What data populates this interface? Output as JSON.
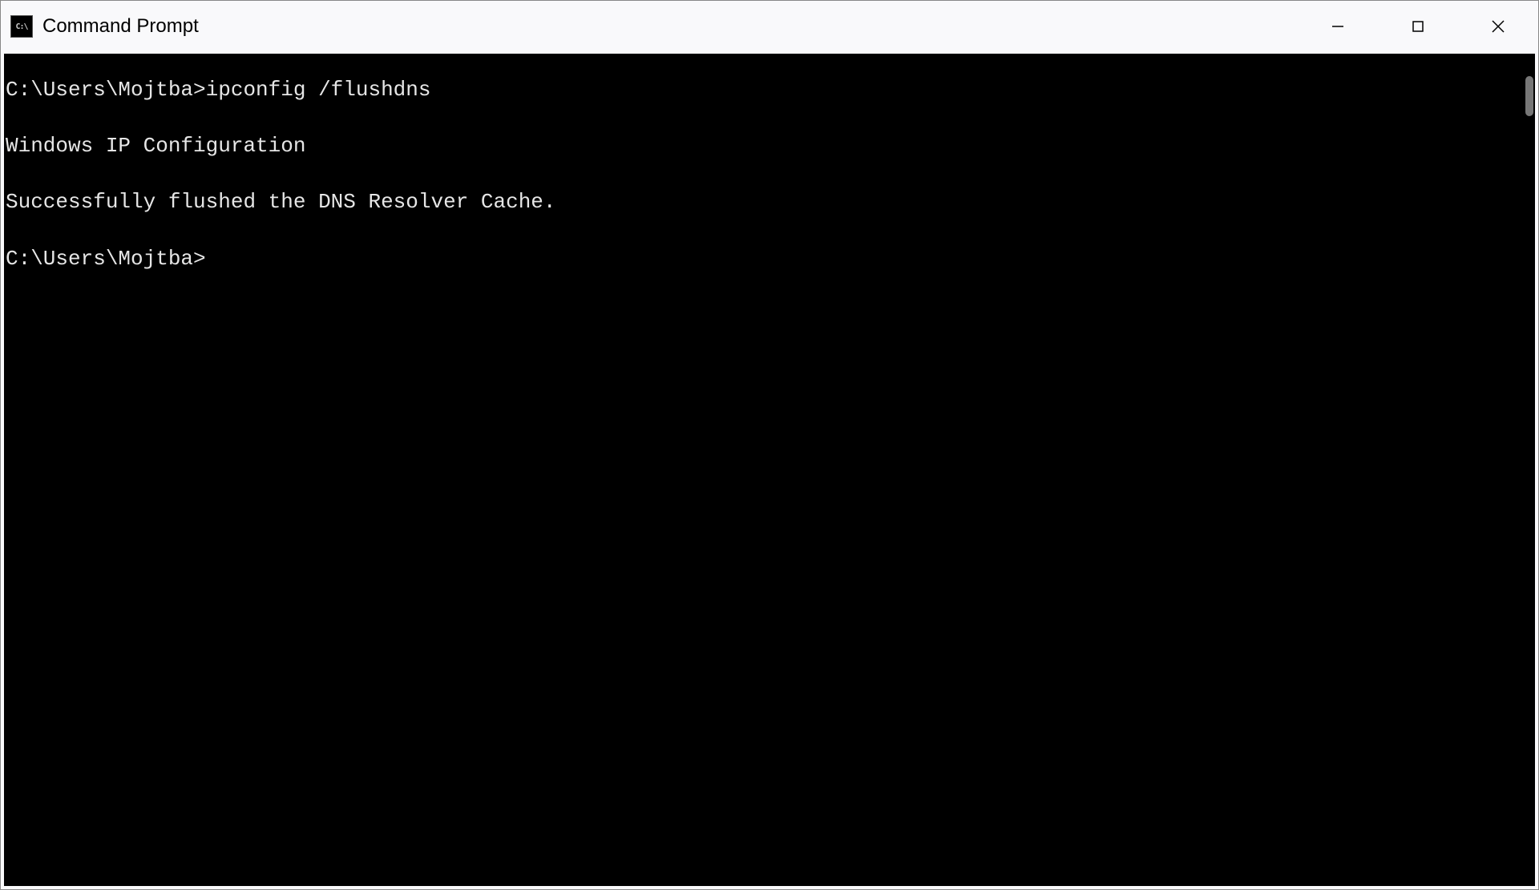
{
  "window": {
    "title": "Command Prompt",
    "icon_label": "C:\\"
  },
  "terminal": {
    "lines": [
      "C:\\Users\\Mojtba>ipconfig /flushdns",
      "",
      "Windows IP Configuration",
      "",
      "Successfully flushed the DNS Resolver Cache.",
      "",
      "C:\\Users\\Mojtba>"
    ]
  }
}
